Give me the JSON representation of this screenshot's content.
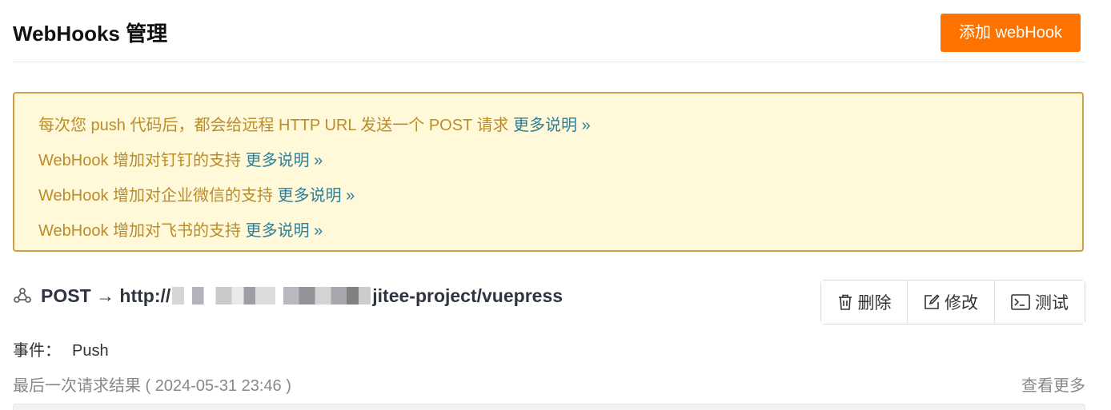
{
  "header": {
    "title": "WebHooks 管理",
    "add_button": "添加 webHook"
  },
  "notice": {
    "lines": [
      {
        "text": "每次您 push 代码后，都会给远程 HTTP URL 发送一个 POST 请求 ",
        "link": "更多说明 »"
      },
      {
        "text": "WebHook 增加对钉钉的支持 ",
        "link": "更多说明 »"
      },
      {
        "text": "WebHook 增加对企业微信的支持 ",
        "link": "更多说明 »"
      },
      {
        "text": "WebHook 增加对飞书的支持 ",
        "link": "更多说明 »"
      }
    ]
  },
  "hook": {
    "method": "POST → http://",
    "url_suffix": "jitee-project/vuepress",
    "actions": {
      "delete": "删除",
      "edit": "修改",
      "test": "测试"
    },
    "events_label": "事件：",
    "events_value": "Push",
    "last_request": "最后一次请求结果 ( 2024-05-31 23:46 )",
    "more": "查看更多"
  },
  "colors": {
    "accent": "#fe7300",
    "notice_bg": "#fff8d9",
    "notice_border": "#c9a243",
    "notice_text": "#b98d2b",
    "link": "#2d7f9a"
  },
  "icons": {
    "hook": "webhook-icon",
    "delete": "trash-icon",
    "edit": "edit-icon",
    "test": "terminal-icon"
  }
}
